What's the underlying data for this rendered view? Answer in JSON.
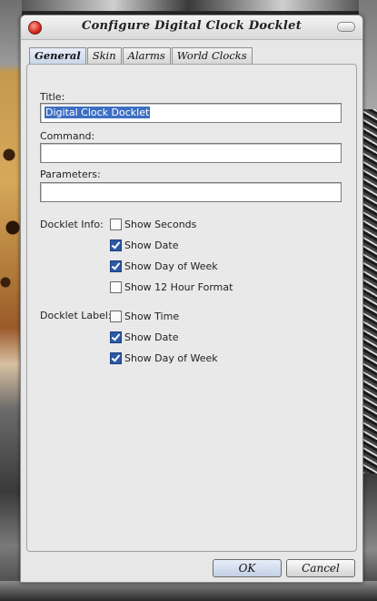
{
  "window": {
    "title": "Configure Digital Clock Docklet"
  },
  "tabs": [
    {
      "label": "General",
      "active": true
    },
    {
      "label": "Skin",
      "active": false
    },
    {
      "label": "Alarms",
      "active": false
    },
    {
      "label": "World Clocks",
      "active": false
    }
  ],
  "fields": {
    "title_label": "Title:",
    "title_value": "Digital Clock Docklet",
    "command_label": "Command:",
    "command_value": "",
    "parameters_label": "Parameters:",
    "parameters_value": ""
  },
  "docklet_info": {
    "label": "Docklet Info:",
    "options": [
      {
        "label": "Show Seconds",
        "checked": false
      },
      {
        "label": "Show Date",
        "checked": true
      },
      {
        "label": "Show Day of Week",
        "checked": true
      },
      {
        "label": "Show 12 Hour Format",
        "checked": false
      }
    ]
  },
  "docklet_label": {
    "label": "Docklet Label:",
    "options": [
      {
        "label": "Show Time",
        "checked": false
      },
      {
        "label": "Show Date",
        "checked": true
      },
      {
        "label": "Show Day of Week",
        "checked": true
      }
    ]
  },
  "buttons": {
    "ok": "OK",
    "cancel": "Cancel"
  },
  "colors": {
    "accent": "#2c5aa6",
    "close": "#d22a1c"
  }
}
